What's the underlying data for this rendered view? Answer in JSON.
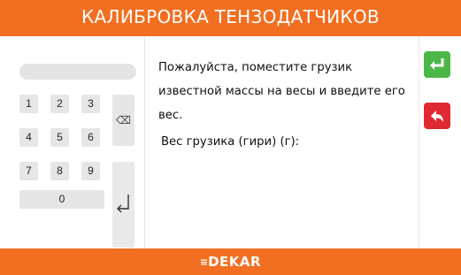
{
  "header": {
    "title": "КАЛИБРОВКА ТЕНЗОДАТЧИКОВ"
  },
  "keypad": {
    "display_value": "",
    "keys": [
      "1",
      "2",
      "3",
      "4",
      "5",
      "6",
      "7",
      "8",
      "9",
      "0"
    ],
    "backspace_icon": "backspace-icon",
    "enter_icon": "enter-arrow-icon"
  },
  "main": {
    "message": "Пожалуйста, поместите грузик известной массы на весы и введите его вес.",
    "weight_label": "Вес грузика (гири) (г):"
  },
  "actions": {
    "confirm_icon": "enter-arrow-icon",
    "back_icon": "undo-arrow-icon",
    "confirm_color": "#4bb747",
    "back_color": "#e02a33"
  },
  "footer": {
    "logo": "DEKAR"
  },
  "colors": {
    "accent": "#f26f21"
  }
}
